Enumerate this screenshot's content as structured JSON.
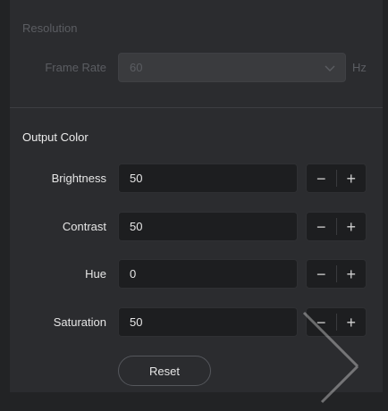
{
  "resolution_label": "Resolution",
  "frame_rate": {
    "label": "Frame Rate",
    "value": "60",
    "unit": "Hz"
  },
  "output_color": {
    "title": "Output Color",
    "rows": [
      {
        "label": "Brightness",
        "value": "50"
      },
      {
        "label": "Contrast",
        "value": "50"
      },
      {
        "label": "Hue",
        "value": "0"
      },
      {
        "label": "Saturation",
        "value": "50"
      }
    ],
    "minus": "−",
    "plus": "+"
  },
  "reset_label": "Reset",
  "colors": {
    "background": "#2b2c2f",
    "field": "#1d1e20",
    "text": "#e6e6e6",
    "disabled_text": "#5b5d62"
  }
}
